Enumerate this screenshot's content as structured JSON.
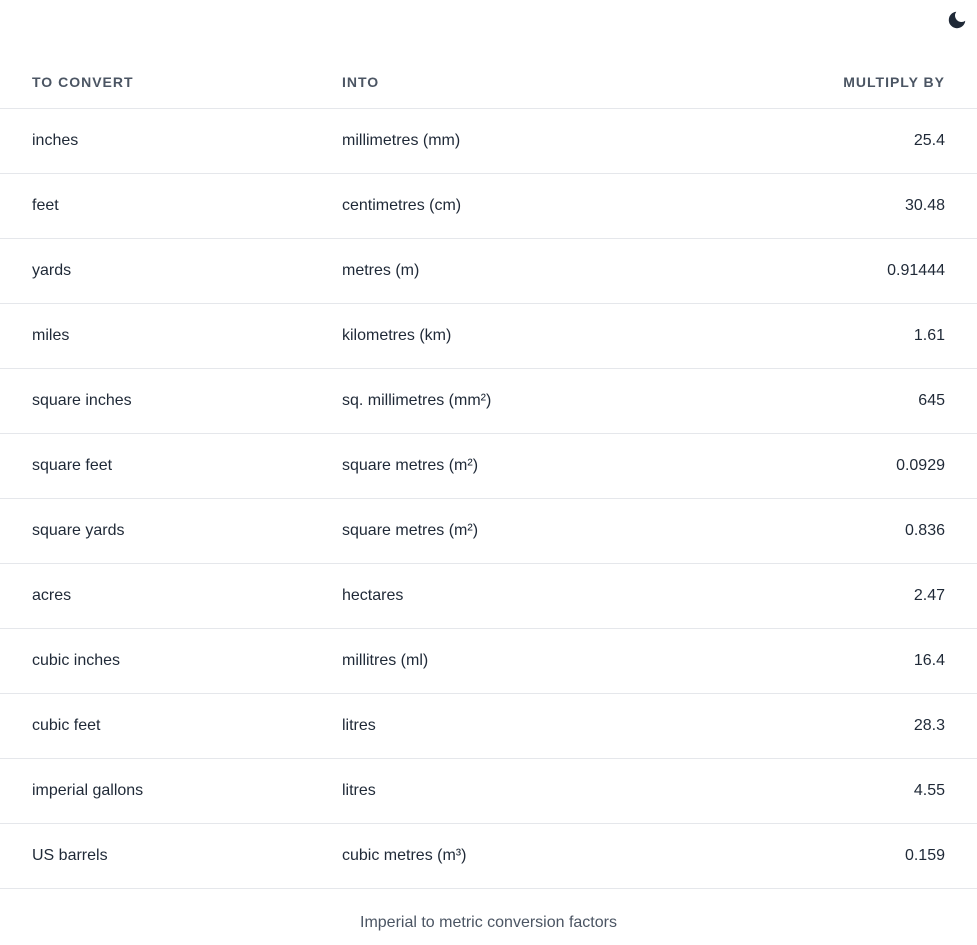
{
  "theme_toggle": {
    "icon": "moon-icon"
  },
  "table": {
    "headers": {
      "from": "TO CONVERT",
      "into": "INTO",
      "factor": "MULTIPLY BY"
    },
    "rows": [
      {
        "from": "inches",
        "into": "millimetres (mm)",
        "factor": "25.4"
      },
      {
        "from": "feet",
        "into": "centimetres (cm)",
        "factor": "30.48"
      },
      {
        "from": "yards",
        "into": "metres (m)",
        "factor": "0.91444"
      },
      {
        "from": "miles",
        "into": "kilometres (km)",
        "factor": "1.61"
      },
      {
        "from": "square inches",
        "into": "sq. millimetres (mm²)",
        "factor": "645"
      },
      {
        "from": "square feet",
        "into": "square metres (m²)",
        "factor": "0.0929"
      },
      {
        "from": "square yards",
        "into": "square metres (m²)",
        "factor": "0.836"
      },
      {
        "from": "acres",
        "into": "hectares",
        "factor": "2.47"
      },
      {
        "from": "cubic inches",
        "into": "millitres (ml)",
        "factor": "16.4"
      },
      {
        "from": "cubic feet",
        "into": "litres",
        "factor": "28.3"
      },
      {
        "from": "imperial gallons",
        "into": "litres",
        "factor": "4.55"
      },
      {
        "from": "US barrels",
        "into": "cubic metres (m³)",
        "factor": "0.159"
      }
    ]
  },
  "caption": "Imperial to metric conversion factors"
}
